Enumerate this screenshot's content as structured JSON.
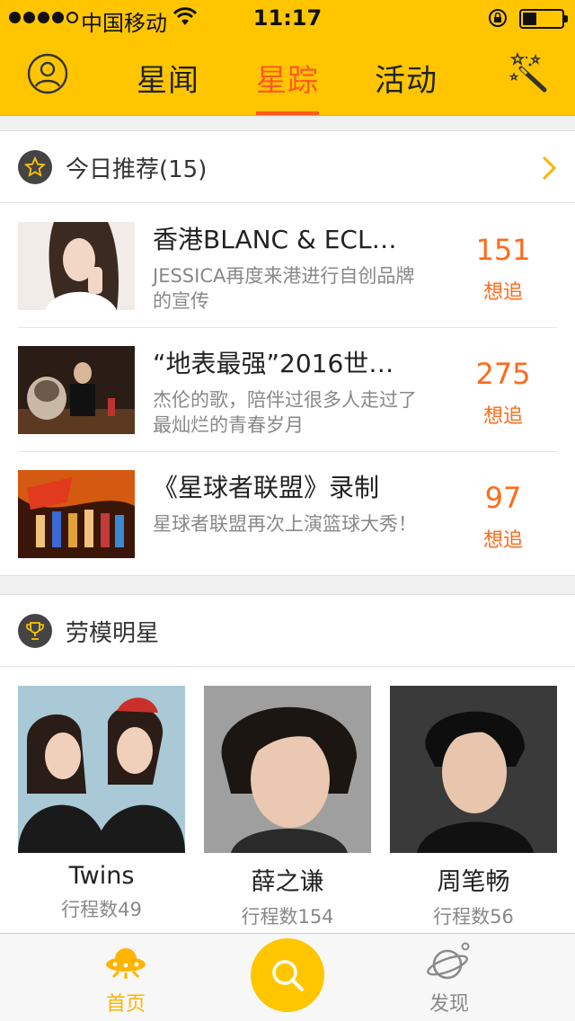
{
  "status_bar": {
    "carrier": "中国移动",
    "time": "11:17",
    "signal_bars": 4,
    "battery_level": 0.35
  },
  "nav": {
    "tabs": [
      {
        "label": "星闻",
        "active": false
      },
      {
        "label": "星踪",
        "active": true
      },
      {
        "label": "活动",
        "active": false
      }
    ]
  },
  "recommend": {
    "title": "今日推荐(15)",
    "items": [
      {
        "title": "香港BLANC & ECL…",
        "desc": "JESSICA再度来港进行自创品牌的宣传",
        "count": "151",
        "unit": "想追"
      },
      {
        "title": "“地表最强”2016世…",
        "desc": "杰伦的歌，陪伴过很多人走过了最灿烂的青春岁月",
        "count": "275",
        "unit": "想追"
      },
      {
        "title": "《星球者联盟》录制",
        "desc": "星球者联盟再次上演篮球大秀！",
        "count": "97",
        "unit": "想追"
      }
    ]
  },
  "stars": {
    "title": "劳模明星",
    "items": [
      {
        "name": "Twins",
        "trips": "行程数49"
      },
      {
        "name": "薛之谦",
        "trips": "行程数154"
      },
      {
        "name": "周笔畅",
        "trips": "行程数56"
      }
    ]
  },
  "tab_bar": {
    "home_label": "首页",
    "discover_label": "发现"
  },
  "colors": {
    "brand_yellow": "#ffc600",
    "accent_orange": "#ff5a1f"
  }
}
